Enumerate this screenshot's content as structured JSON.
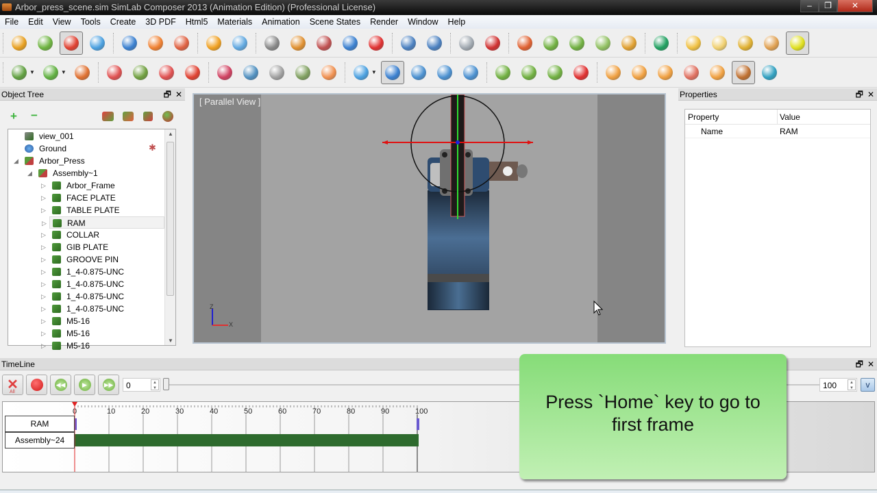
{
  "window": {
    "title": "Arbor_press_scene.sim SimLab Composer 2013 (Animation Edition)   (Professional License)",
    "controls": {
      "minimize": "–",
      "restore": "❐",
      "close": "✕"
    }
  },
  "menu": [
    "File",
    "Edit",
    "View",
    "Tools",
    "Create",
    "3D PDF",
    "Html5",
    "Materials",
    "Animation",
    "Scene States",
    "Render",
    "Window",
    "Help"
  ],
  "toolbar_row1": [
    {
      "name": "select-target-icon",
      "color": "#e8a020"
    },
    {
      "name": "rotate-icon",
      "color": "#6db33f"
    },
    {
      "name": "transform-icon",
      "color": "#e04030",
      "active": true
    },
    {
      "name": "move-object-icon",
      "color": "#4aa0e0"
    },
    {
      "name": "sep"
    },
    {
      "name": "move-arrows-icon",
      "color": "#3a80d0"
    },
    {
      "name": "snap-point-icon",
      "color": "#f08030"
    },
    {
      "name": "snap-two-points-icon",
      "color": "#e06040"
    },
    {
      "name": "sep"
    },
    {
      "name": "place-on-ground-icon",
      "color": "#f0a020"
    },
    {
      "name": "place-on-object-icon",
      "color": "#60a8e0"
    },
    {
      "name": "sep"
    },
    {
      "name": "hide-icon",
      "color": "#888888"
    },
    {
      "name": "show-icon",
      "color": "#e09030"
    },
    {
      "name": "remove-transform-icon",
      "color": "#c05050"
    },
    {
      "name": "explode-icon",
      "color": "#3a80d0"
    },
    {
      "name": "delete-icon",
      "color": "#e03030"
    },
    {
      "name": "sep"
    },
    {
      "name": "undo-icon",
      "color": "#4a80c0"
    },
    {
      "name": "redo-icon",
      "color": "#4a80c0"
    },
    {
      "name": "sep"
    },
    {
      "name": "measure-icon",
      "color": "#a0a8b0"
    },
    {
      "name": "record-camera-icon",
      "color": "#d03030"
    },
    {
      "name": "sep"
    },
    {
      "name": "rotate-object-animation-icon",
      "color": "#e06030"
    },
    {
      "name": "camera-orbit-icon",
      "color": "#70b040"
    },
    {
      "name": "camera-animation-icon",
      "color": "#70b040"
    },
    {
      "name": "spin-icon",
      "color": "#90c060"
    },
    {
      "name": "turntable-icon",
      "color": "#e0a030"
    },
    {
      "name": "sep"
    },
    {
      "name": "environment-sphere-icon",
      "color": "#20a060"
    },
    {
      "name": "sep"
    },
    {
      "name": "point-light-icon",
      "color": "#f0c040"
    },
    {
      "name": "area-light-icon",
      "color": "#f0d070"
    },
    {
      "name": "spot-light-icon",
      "color": "#e0b030"
    },
    {
      "name": "directional-light-icon",
      "color": "#e0a050"
    },
    {
      "name": "light-camera-icon",
      "color": "#e0e020",
      "active": true
    }
  ],
  "toolbar_row2": [
    {
      "name": "select-mode-icon",
      "color": "#60a040",
      "dropdown": true
    },
    {
      "name": "select-object-icon",
      "color": "#60b040",
      "dropdown": true
    },
    {
      "name": "select-part-icon",
      "color": "#e07030"
    },
    {
      "name": "sep"
    },
    {
      "name": "zoom-fit-icon",
      "color": "#e05050"
    },
    {
      "name": "zoom-selected-icon",
      "color": "#70a040"
    },
    {
      "name": "zoom-extents-icon",
      "color": "#e05050"
    },
    {
      "name": "zoom-object-icon",
      "color": "#e04030"
    },
    {
      "name": "sep"
    },
    {
      "name": "orbit-icon",
      "color": "#d04060"
    },
    {
      "name": "pan-camera-icon",
      "color": "#5090c0"
    },
    {
      "name": "camera-icon",
      "color": "#a0a0a0"
    },
    {
      "name": "image-icon",
      "color": "#80a060"
    },
    {
      "name": "materials-icon",
      "color": "#f09050"
    },
    {
      "name": "sep"
    },
    {
      "name": "view-cube-icon",
      "color": "#4aa0e0",
      "dropdown": true
    },
    {
      "name": "selection-cursor-icon",
      "color": "#3a80d0",
      "active": true
    },
    {
      "name": "pick-icon",
      "color": "#4a90d0"
    },
    {
      "name": "box-select-icon",
      "color": "#4a90d0"
    },
    {
      "name": "gear-select-icon",
      "color": "#4a90d0"
    },
    {
      "name": "sep"
    },
    {
      "name": "rewind-icon",
      "color": "#70b040"
    },
    {
      "name": "play-icon",
      "color": "#70b040"
    },
    {
      "name": "fast-forward-icon",
      "color": "#70b040"
    },
    {
      "name": "record-icon",
      "color": "#e03030"
    },
    {
      "name": "sep"
    },
    {
      "name": "search-scene-icon",
      "color": "#f0a040"
    },
    {
      "name": "scene-state-icon",
      "color": "#f0a040"
    },
    {
      "name": "scene-image-icon",
      "color": "#f0a040"
    },
    {
      "name": "scene-state-delete-icon",
      "color": "#e07060"
    },
    {
      "name": "scene-state-list-icon",
      "color": "#f0a040"
    },
    {
      "name": "settings-gears-icon",
      "color": "#c07030",
      "active": true
    },
    {
      "name": "color-diamond-icon",
      "color": "#30a0c0"
    }
  ],
  "object_tree": {
    "title": "Object Tree",
    "add_label": "+",
    "remove_label": "−",
    "items": [
      {
        "label": "view_001",
        "depth": 0,
        "icon": "camera-view-icon",
        "arrow": ""
      },
      {
        "label": "Ground",
        "depth": 0,
        "icon": "globe-icon",
        "arrow": ""
      },
      {
        "label": "Arbor_Press",
        "depth": 0,
        "icon": "assembly-icon",
        "arrow": "◢"
      },
      {
        "label": "Assembly~1",
        "depth": 1,
        "icon": "assembly-icon",
        "arrow": "◢"
      },
      {
        "label": "Arbor_Frame",
        "depth": 2,
        "icon": "part-icon",
        "arrow": "▷"
      },
      {
        "label": "FACE PLATE",
        "depth": 2,
        "icon": "part-icon",
        "arrow": "▷"
      },
      {
        "label": "TABLE PLATE",
        "depth": 2,
        "icon": "part-icon",
        "arrow": "▷"
      },
      {
        "label": "RAM",
        "depth": 2,
        "icon": "part-icon",
        "arrow": "▷",
        "selected": true
      },
      {
        "label": "COLLAR",
        "depth": 2,
        "icon": "part-icon",
        "arrow": "▷"
      },
      {
        "label": "GIB PLATE",
        "depth": 2,
        "icon": "part-icon",
        "arrow": "▷"
      },
      {
        "label": "GROOVE PIN",
        "depth": 2,
        "icon": "part-icon",
        "arrow": "▷"
      },
      {
        "label": "1_4-0.875-UNC",
        "depth": 2,
        "icon": "part-icon",
        "arrow": "▷"
      },
      {
        "label": "1_4-0.875-UNC",
        "depth": 2,
        "icon": "part-icon",
        "arrow": "▷"
      },
      {
        "label": "1_4-0.875-UNC",
        "depth": 2,
        "icon": "part-icon",
        "arrow": "▷"
      },
      {
        "label": "1_4-0.875-UNC",
        "depth": 2,
        "icon": "part-icon",
        "arrow": "▷"
      },
      {
        "label": "M5-16",
        "depth": 2,
        "icon": "part-icon",
        "arrow": "▷"
      },
      {
        "label": "M5-16",
        "depth": 2,
        "icon": "part-icon",
        "arrow": "▷"
      },
      {
        "label": "M5-16",
        "depth": 2,
        "icon": "part-icon",
        "arrow": "▷"
      }
    ]
  },
  "viewport": {
    "label": "[ Parallel View ]",
    "axis_z": "Z",
    "axis_x": "X"
  },
  "properties": {
    "title": "Properties",
    "col_property": "Property",
    "col_value": "Value",
    "rows": [
      {
        "property": "Name",
        "value": "RAM"
      }
    ]
  },
  "timeline": {
    "title": "TimeLine",
    "delete_all_label": "All",
    "current_frame": "0",
    "end_frame": "100",
    "v_button": "v",
    "scale_min": 0,
    "scale_max": 100,
    "ticks": [
      "0",
      "10",
      "20",
      "30",
      "40",
      "50",
      "60",
      "70",
      "80",
      "90",
      "100"
    ],
    "tracks": [
      {
        "label": "RAM",
        "keyframes": [
          0,
          100
        ]
      },
      {
        "label": "Assembly~24",
        "bar": [
          0,
          100
        ]
      }
    ],
    "playhead": 0
  },
  "tip": {
    "text_line1": "Press `Home` key to go to",
    "text_line2": "first frame"
  },
  "panel_controls": {
    "float": "🗗",
    "close": "✕"
  }
}
